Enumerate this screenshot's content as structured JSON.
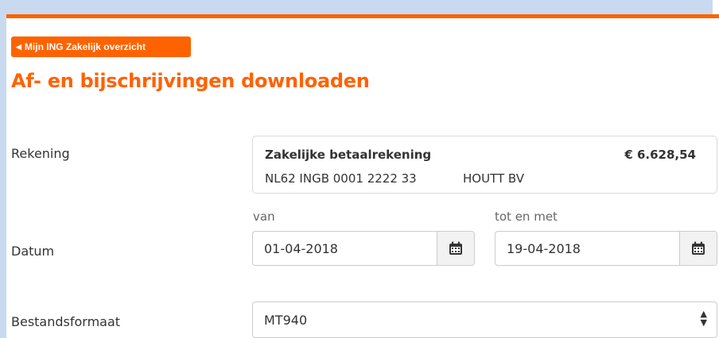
{
  "header": {
    "back_button_label": "Mijn ING Zakelijk overzicht",
    "page_title": "Af- en bijschrijvingen downloaden"
  },
  "account": {
    "label": "Rekening",
    "name": "Zakelijke betaalrekening",
    "balance": "€ 6.628,54",
    "iban": "NL62 INGB 0001 2222 33",
    "holder": "HOUTT BV"
  },
  "date": {
    "label": "Datum",
    "from_label": "van",
    "from_value": "01-04-2018",
    "to_label": "tot en met",
    "to_value": "19-04-2018"
  },
  "file_format": {
    "label": "Bestandsformaat",
    "selected": "MT940"
  },
  "colors": {
    "brand_orange": "#ff6200",
    "window_background": "#c9daf0"
  },
  "icons": {
    "back": "caret-left-icon",
    "calendar": "calendar-icon",
    "select": "select-arrows-icon"
  }
}
